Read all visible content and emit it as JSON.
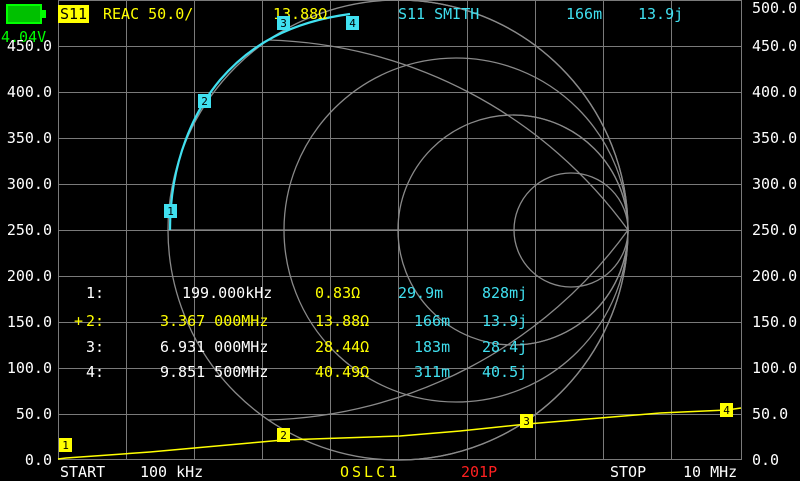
{
  "battery": {
    "voltage": "4.04V",
    "color": "#00ff00",
    "level": 1.0
  },
  "header": {
    "trace1_chip": "S11",
    "trace1_format": "REAC 50.0/",
    "trace1_value": "13.88Ω",
    "trace2_label": "S11 SMITH",
    "trace2_real": "166m",
    "trace2_imag": "13.9j"
  },
  "y_axis_left": [
    "450.0",
    "400.0",
    "350.0",
    "300.0",
    "250.0",
    "200.0",
    "150.0",
    "100.0",
    "50.0",
    "0.0"
  ],
  "y_axis_right": [
    "500.0",
    "450.0",
    "400.0",
    "350.0",
    "300.0",
    "250.0",
    "200.0",
    "150.0",
    "100.0",
    "50.0",
    "0.0"
  ],
  "markers": [
    {
      "id": "1:",
      "active": false,
      "freq": "199.000kHz",
      "reac": "0.83Ω",
      "real": "29.9m",
      "imag": "828mj"
    },
    {
      "id": "2:",
      "active": true,
      "freq": "3.367 000MHz",
      "reac": "13.88Ω",
      "real": "166m",
      "imag": "13.9j"
    },
    {
      "id": "3:",
      "active": false,
      "freq": "6.931 000MHz",
      "reac": "28.44Ω",
      "real": "183m",
      "imag": "28.4j"
    },
    {
      "id": "4:",
      "active": false,
      "freq": "9.851 500MHz",
      "reac": "40.49Ω",
      "real": "311m",
      "imag": "40.5j"
    }
  ],
  "marker_tags": [
    "1",
    "2",
    "3",
    "4"
  ],
  "footer": {
    "start_label": "START",
    "start_value": "100 kHz",
    "cal_status": "OSLC1",
    "points": "201P",
    "stop_label": "STOP",
    "stop_value": "10 MHz"
  },
  "colors": {
    "trace_reac": "#ffff00",
    "trace_smith": "#40e0f0",
    "grid": "#808080",
    "points": "#ff2020"
  }
}
